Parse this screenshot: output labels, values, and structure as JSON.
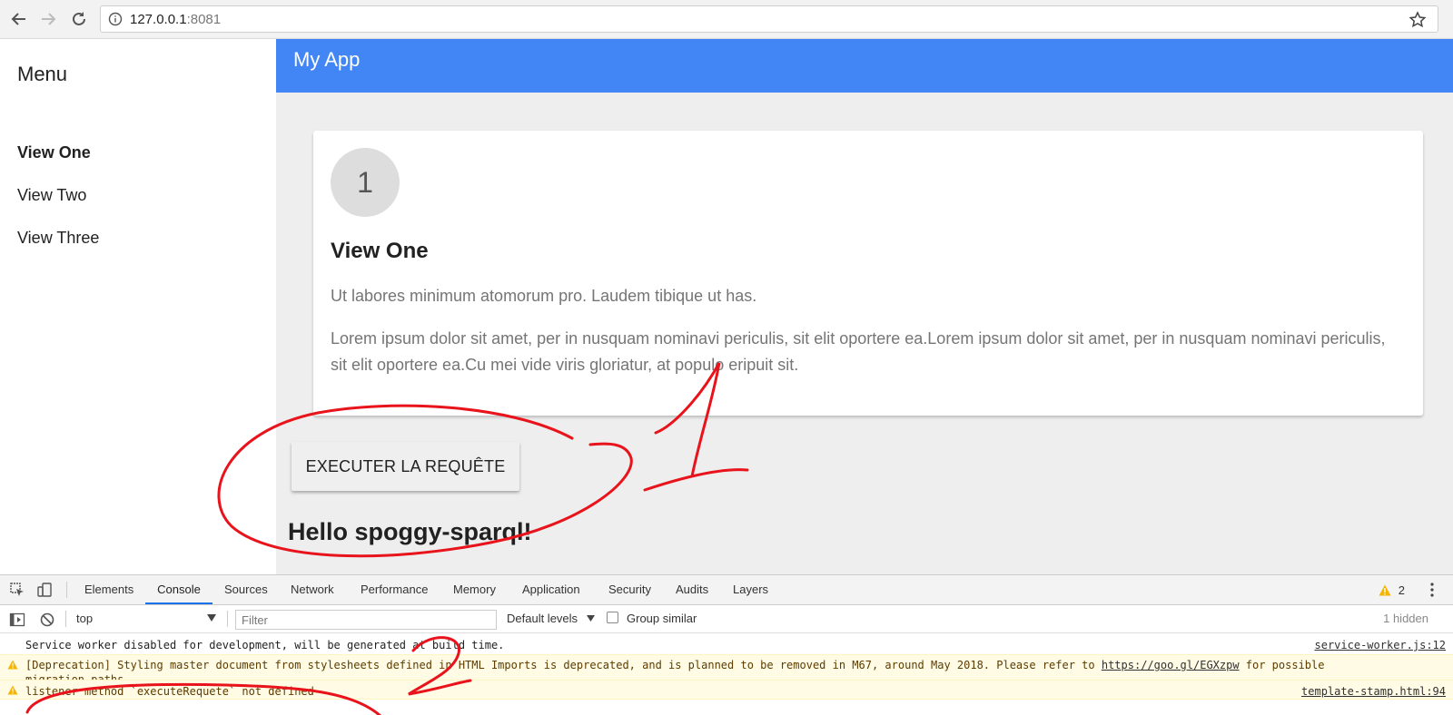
{
  "browser": {
    "url_host": "127.0.0.1",
    "url_port": ":8081"
  },
  "drawer": {
    "title": "Menu",
    "items": [
      {
        "label": "View One",
        "selected": true
      },
      {
        "label": "View Two",
        "selected": false
      },
      {
        "label": "View Three",
        "selected": false
      }
    ]
  },
  "header": {
    "title": "My App"
  },
  "card": {
    "circle_number": "1",
    "heading": "View One",
    "paragraph_1": "Ut labores minimum atomorum pro. Laudem tibique ut has.",
    "paragraph_2": "Lorem ipsum dolor sit amet, per in nusquam nominavi periculis, sit elit oportere ea.Lorem ipsum dolor sit amet, per in nusquam nominavi periculis, sit elit oportere ea.Cu mei vide viris gloriatur, at populo eripuit sit."
  },
  "main": {
    "execute_button": "EXECUTER LA REQUÊTE",
    "hello_text": "Hello spoggy-sparql!"
  },
  "devtools": {
    "tabs": [
      "Elements",
      "Console",
      "Sources",
      "Network",
      "Performance",
      "Memory",
      "Application",
      "Security",
      "Audits",
      "Layers"
    ],
    "active_tab": "Console",
    "warning_count": "2",
    "context": "top",
    "filter_placeholder": "Filter",
    "levels": "Default levels",
    "group_similar": "Group similar",
    "hidden_count": "1 hidden",
    "logs": [
      {
        "type": "info",
        "message": "Service worker disabled for development, will be generated at build time.",
        "source": "service-worker.js:12"
      },
      {
        "type": "warning",
        "message_prefix": "[Deprecation] Styling master document from stylesheets defined in HTML Imports is deprecated, and is planned to be removed in M67, around May 2018. Please refer to ",
        "link": "https://goo.gl/EGXzpw",
        "message_suffix": " for possible",
        "message_line2": "migration paths.",
        "source": ""
      },
      {
        "type": "warning",
        "message": "listener method `executeRequete` not defined",
        "source": "template-stamp.html:94"
      }
    ]
  },
  "annotation_color": "#e8131b"
}
